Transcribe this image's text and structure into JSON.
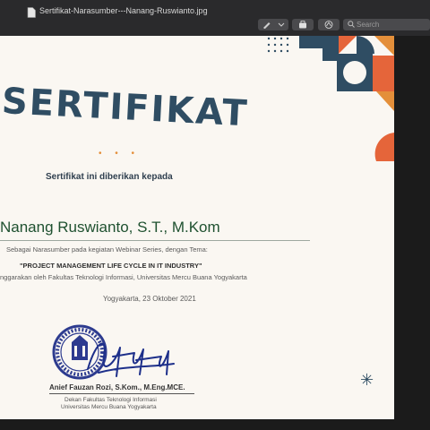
{
  "window": {
    "title": "Sertifikat-Narasumber---Nanang-Ruswianto.jpg",
    "search_placeholder": "Search"
  },
  "certificate": {
    "heading": "SERTIFIKAT",
    "ornament": "• • •",
    "given_to": "Sertifikat ini diberikan kepada",
    "recipient": "Nanang Ruswianto, S.T., M.Kom",
    "as_line": "Sebagai Narasumber pada kegiatan Webinar Series, dengan Tema:",
    "theme": "\"PROJECT MANAGEMENT LIFE CYCLE IN IT INDUSTRY\"",
    "organizer": "nggarakan oleh Fakultas Teknologi Informasi, Universitas Mercu Buana Yogyakarta",
    "date": "Yogyakarta, 23 Oktober 2021",
    "signer_name": "Anief Fauzan Rozi, S.Kom., M.Eng.MCE.",
    "signer_role": "Dekan Fakultas Teknologi Informasi",
    "signer_university": "Universitas Mercu Buana Yogyakarta",
    "colors": {
      "navy": "#2f4d63",
      "orange": "#e5653a",
      "gold": "#e48f3a",
      "green": "#1f5130"
    }
  }
}
